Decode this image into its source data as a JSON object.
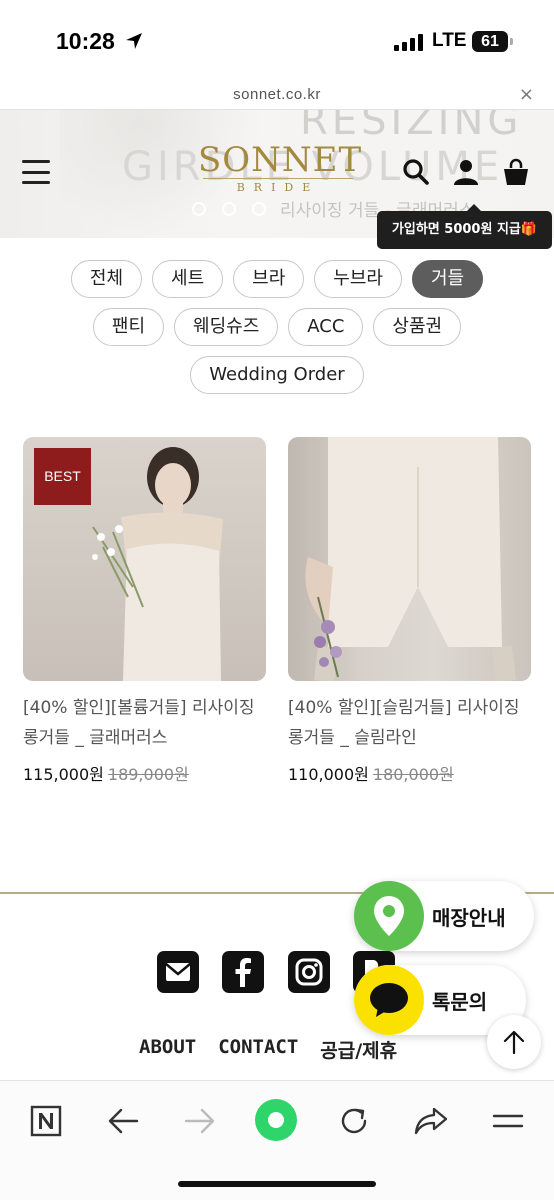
{
  "status": {
    "time": "10:28",
    "network": "LTE",
    "battery": "61"
  },
  "browser": {
    "url": "sonnet.co.kr",
    "close": "×"
  },
  "hero": {
    "bg_text_1": "RESIZING",
    "bg_text_2": "GIRDLE VOLUME",
    "bg_text_3": "리사이징 거들 - 글래머러스",
    "logo_main": "SONNET",
    "logo_sub": "BRIDE",
    "slide_count": 3
  },
  "tooltip": "가입하면 5000원 지급🎁",
  "categories": {
    "row1": [
      {
        "label": "전체",
        "active": false
      },
      {
        "label": "세트",
        "active": false
      },
      {
        "label": "브라",
        "active": false
      },
      {
        "label": "누브라",
        "active": false
      },
      {
        "label": "거들",
        "active": true
      }
    ],
    "row2": [
      {
        "label": "팬티",
        "active": false
      },
      {
        "label": "웨딩슈즈",
        "active": false
      },
      {
        "label": "ACC",
        "active": false
      },
      {
        "label": "상품권",
        "active": false
      }
    ],
    "row3": [
      {
        "label": "Wedding Order",
        "active": false
      }
    ]
  },
  "products": [
    {
      "badge": "BEST",
      "name": "[40% 할인][볼륨거들] 리사이징 롱거들 _ 글래머러스",
      "price": "115,000원",
      "original_price": "189,000원"
    },
    {
      "badge": "",
      "name": "[40% 할인][슬림거들] 리사이징 롱거들 _ 슬림라인",
      "price": "110,000원",
      "original_price": "180,000원"
    }
  ],
  "footer": {
    "social_icons": [
      "mail-icon",
      "facebook-icon",
      "instagram-icon",
      "blog-icon"
    ],
    "links": [
      "ABOUT",
      "CONTACT",
      "공급/제휴"
    ]
  },
  "floating": {
    "store": "매장안내",
    "talk": "톡문의"
  },
  "colors": {
    "brand_gold": "#a38a3e",
    "active_chip": "#5d5d5d",
    "best_badge": "#8e1c1c",
    "store_green": "#5cc04f",
    "talk_yellow": "#fae100",
    "naver_green": "#2fd46a"
  },
  "bottom_bar": [
    "naver-n-icon",
    "back-icon",
    "forward-icon",
    "naver-home-icon",
    "refresh-icon",
    "share-icon",
    "menu-icon"
  ]
}
